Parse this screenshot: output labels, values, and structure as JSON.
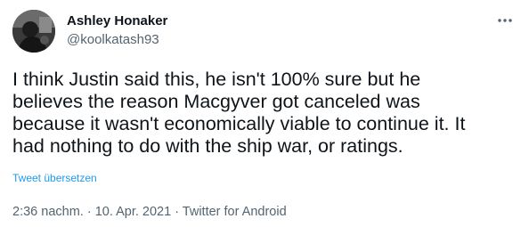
{
  "author": {
    "name": "Ashley Honaker",
    "handle": "@koolkatash93"
  },
  "icons": {
    "avatar": "profile-photo",
    "more": "more-dots-icon"
  },
  "tweet": {
    "text": "I think Justin said this, he isn't 100% sure but he\nbelieves the reason Macgyver got canceled was\nbecause it wasn't economically viable to continue it. It\nhad nothing to do with the ship war, or ratings.",
    "translate_label": "Tweet übersetzen"
  },
  "meta": {
    "time": "2:36 nachm.",
    "separator": " · ",
    "date": "10. Apr. 2021",
    "source": "Twitter for Android"
  },
  "colors": {
    "text": "#0f1419",
    "secondary": "#536471",
    "link": "#1d9bf0"
  }
}
